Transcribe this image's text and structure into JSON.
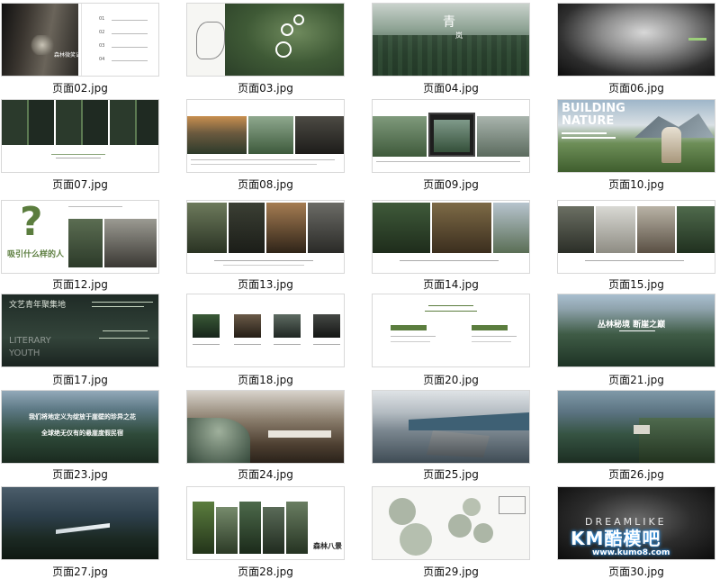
{
  "thumbnails": [
    {
      "file": "页面02.jpg",
      "text": [
        "森林微笑记",
        "01",
        "02",
        "03",
        "04"
      ]
    },
    {
      "file": "页面03.jpg",
      "text": []
    },
    {
      "file": "页面04.jpg",
      "text": [
        "青",
        "岚"
      ]
    },
    {
      "file": "页面06.jpg",
      "text": []
    },
    {
      "file": "页面07.jpg",
      "text": []
    },
    {
      "file": "页面08.jpg",
      "text": []
    },
    {
      "file": "页面09.jpg",
      "text": []
    },
    {
      "file": "页面10.jpg",
      "text": [
        "BUILDING",
        "NATURE"
      ]
    },
    {
      "file": "页面12.jpg",
      "text": [
        "?",
        "吸引什么样的人"
      ]
    },
    {
      "file": "页面13.jpg",
      "text": []
    },
    {
      "file": "页面14.jpg",
      "text": []
    },
    {
      "file": "页面15.jpg",
      "text": []
    },
    {
      "file": "页面17.jpg",
      "text": [
        "文艺青年聚集地",
        "LITERARY",
        "YOUTH"
      ]
    },
    {
      "file": "页面18.jpg",
      "text": []
    },
    {
      "file": "页面20.jpg",
      "text": []
    },
    {
      "file": "页面21.jpg",
      "text": [
        "丛林秘境 断崖之巅"
      ]
    },
    {
      "file": "页面23.jpg",
      "text": [
        "我们将地定义为绽放于崖壁的珍异之花",
        "全球绝无仅有的悬崖度假民宿"
      ]
    },
    {
      "file": "页面24.jpg",
      "text": []
    },
    {
      "file": "页面25.jpg",
      "text": []
    },
    {
      "file": "页面26.jpg",
      "text": []
    },
    {
      "file": "页面27.jpg",
      "text": []
    },
    {
      "file": "页面28.jpg",
      "text": [
        "森林八景"
      ]
    },
    {
      "file": "页面29.jpg",
      "text": []
    },
    {
      "file": "页面30.jpg",
      "text": [
        "DREAMLIKE"
      ]
    }
  ],
  "watermark": {
    "brand": "KM酷模吧",
    "url": "www.kumo8.com"
  },
  "colors": {
    "accent_green": "#5b7d3e",
    "caption_text": "#111111",
    "watermark_glow": "#39a9ff"
  }
}
